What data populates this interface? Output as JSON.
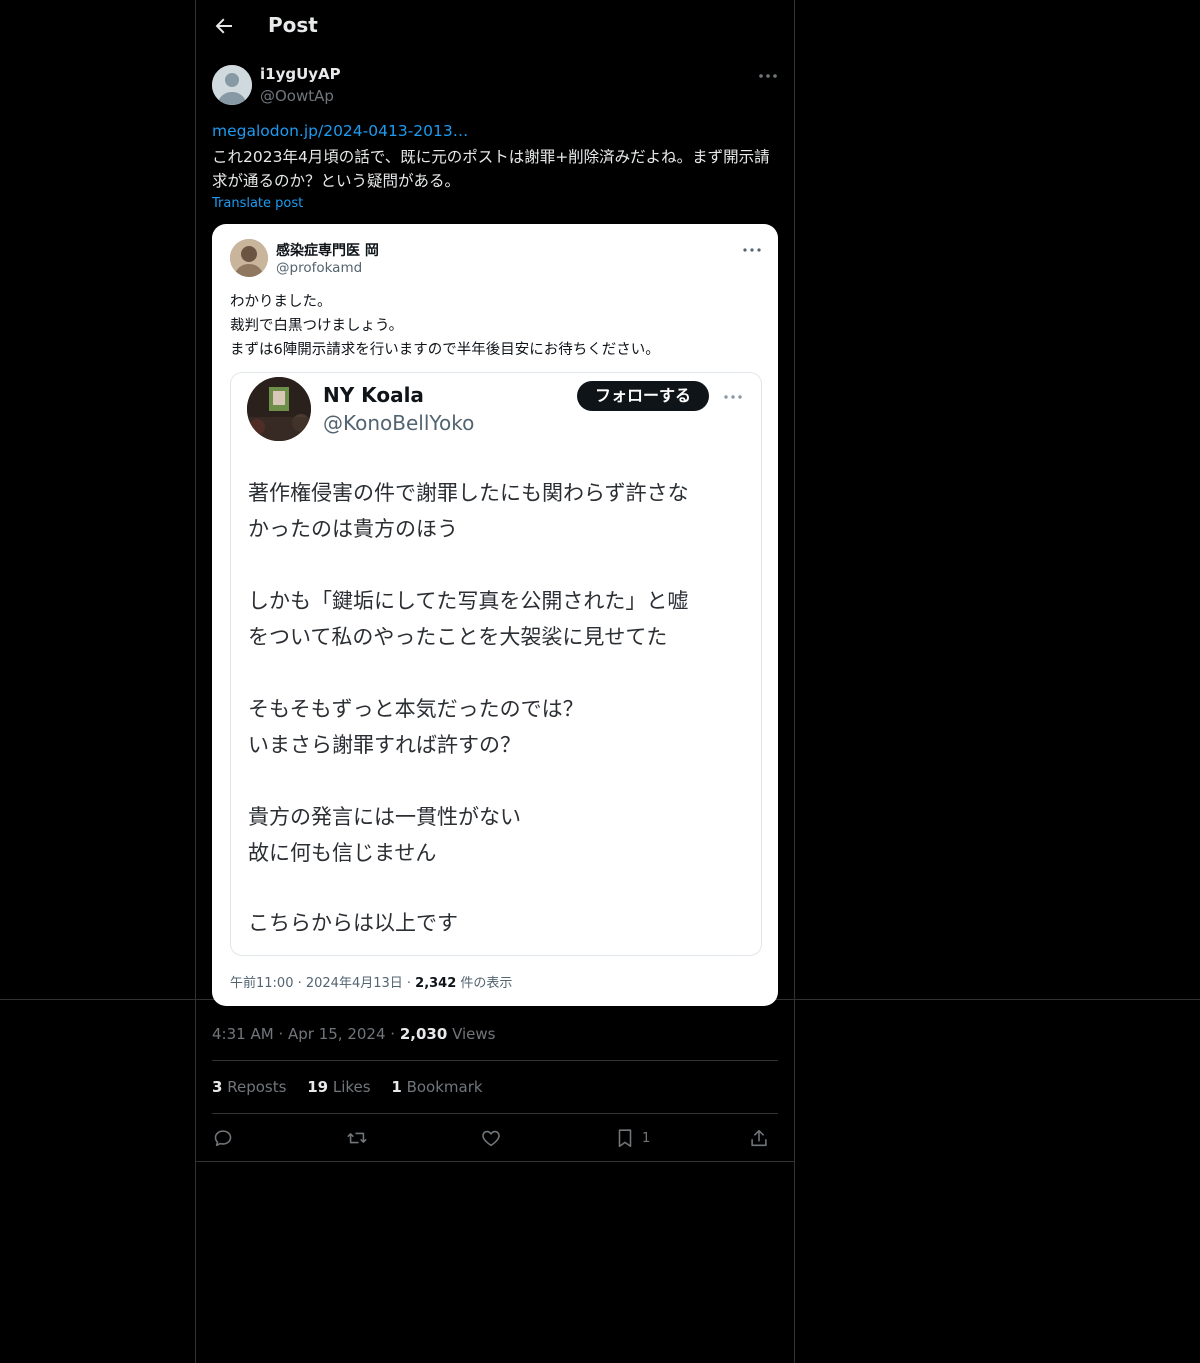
{
  "header": {
    "title": "Post"
  },
  "post": {
    "author_name": "i1ygUyAP",
    "author_handle": "@OowtAp",
    "link": "megalodon.jp/2024-0413-2013…",
    "text": "これ2023年4月頃の話で、既に元のポストは謝罪+削除済みだよね。まず開示請求が通るのか？という疑問がある。",
    "translate_label": "Translate post",
    "time": "4:31 AM",
    "date": "Apr 15, 2024",
    "views_count": "2,030",
    "views_label": "Views",
    "reposts_count": "3",
    "reposts_label": "Reposts",
    "likes_count": "19",
    "likes_label": "Likes",
    "bookmarks_count": "1",
    "bookmarks_label": "Bookmark",
    "bookmark_action_count": "1"
  },
  "embedded": {
    "name": "感染症専門医 岡",
    "handle": "@profokamd",
    "lines": [
      "わかりました。",
      "裁判で白黒つけましょう。",
      "まずは6陣開示請求を行いますので半年後目安にお待ちください。"
    ],
    "meta_prefix": "午前11:00 · 2024年4月13日 · ",
    "meta_views": "2,342",
    "meta_suffix": " 件の表示",
    "quoted": {
      "name": "NY Koala",
      "handle": "@KonoBellYoko",
      "follow_label": "フォローする",
      "paragraphs": [
        "著作権侵害の件で謝罪したにも関わらず許さな\nかったのは貴方のほう",
        "しかも「鍵垢にしてた写真を公開された」と嘘\nをついて私のやったことを大袈裟に見せてた",
        "そもそもずっと本気だったのでは？\nいまさら謝罪すれば許すの？",
        "貴方の発言には一貫性がない\n故に何も信じません",
        "こちらからは以上です"
      ]
    }
  },
  "colors": {
    "background": "#000000",
    "text": "#e7e9ea",
    "muted": "#71767b",
    "accent": "#1d9bf0",
    "border": "#2f3336"
  },
  "icons": {
    "back": "arrow-left-icon",
    "more": "more-horizontal-icon",
    "reply": "reply-icon",
    "repost": "repost-icon",
    "like": "heart-icon",
    "bookmark": "bookmark-icon",
    "share": "share-icon"
  }
}
